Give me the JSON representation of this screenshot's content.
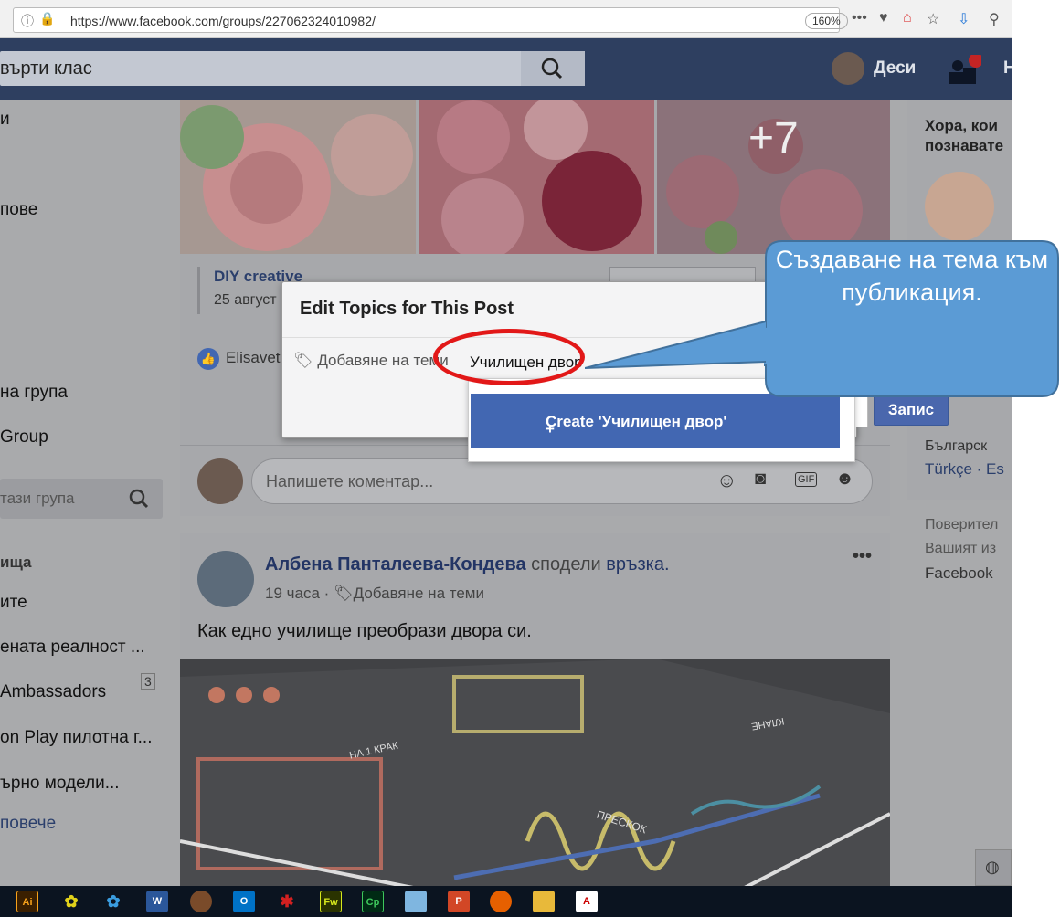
{
  "browser": {
    "url": "https://www.facebook.com/groups/227062324010982/",
    "zoom": "160%"
  },
  "header": {
    "search_text": "върти клас",
    "user_name": "Деси",
    "edge_letter": "Н"
  },
  "sidebar": {
    "items": [
      "и",
      "пове",
      "на група",
      "Group"
    ],
    "search_placeholder": "тази група",
    "section_title": "ища",
    "groups": [
      "ите",
      "ената реалност ...",
      "Ambassadors",
      "on Play пилотна г...",
      "ърно модели..."
    ],
    "badge": "3",
    "more": "повече"
  },
  "post1": {
    "plus_count": "+7",
    "creator": "DIY creative",
    "date": "25 август",
    "liker": "Elisavet",
    "comment_placeholder": "Напишете коментар..."
  },
  "post2": {
    "author": "Албена Панталеева-Кондева",
    "shared": "сподели",
    "link": "връзка",
    "time": "19 часа",
    "add_topics": "Добавяне на теми",
    "text": "Как едно училище преобрази двора си.",
    "image_labels": [
      "НА 1 КРАК",
      "ПРЕСКОК",
      "КЛАНЕ"
    ]
  },
  "modal": {
    "title": "Edit Topics for This Post",
    "add_topics": "Добавяне на теми",
    "input_value": "Училищен двор",
    "create_option": "Create 'Училищен двор'",
    "save": "Запис"
  },
  "right": {
    "people_title": "Хора, кои",
    "people_sub": "познавате",
    "langs_1": "Българск",
    "langs_2": "Türkçe · Es",
    "footer_1": "Поверител",
    "footer_2": "Вашият из",
    "footer_3": "Facebook"
  },
  "callout": {
    "text": "Създаване на тема към публикация."
  },
  "colors": {
    "accent": "#4267b2",
    "callout": "#5b9bd5",
    "highlight": "#e21818"
  }
}
